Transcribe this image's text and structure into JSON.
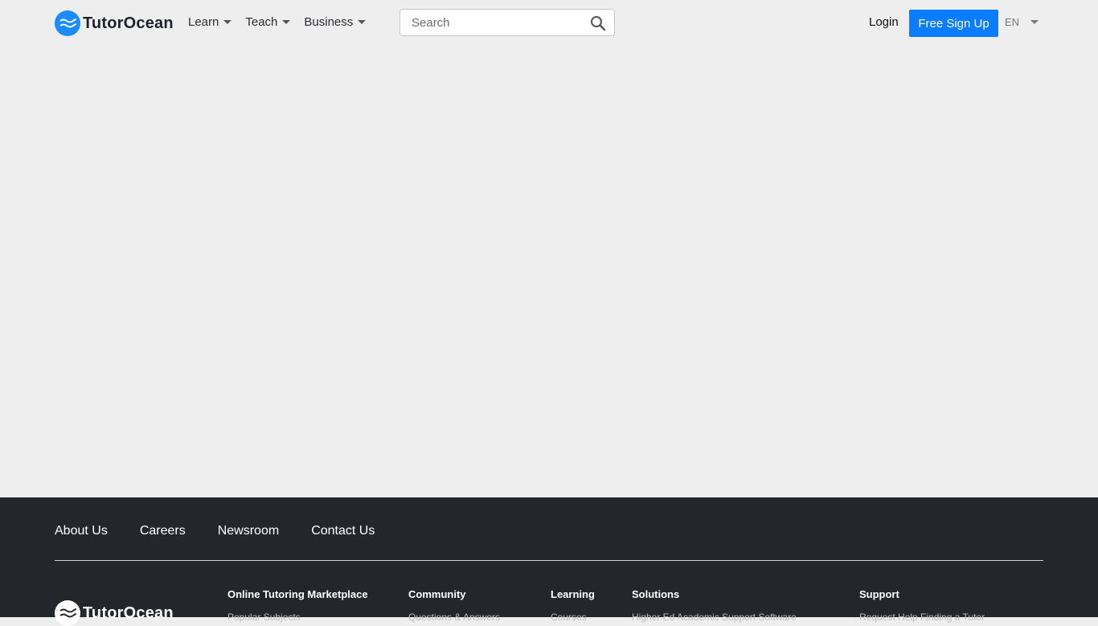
{
  "header": {
    "brand": "TutorOcean",
    "nav": [
      {
        "label": "Learn"
      },
      {
        "label": "Teach"
      },
      {
        "label": "Business"
      }
    ],
    "search": {
      "placeholder": "Search",
      "value": ""
    },
    "login_label": "Login",
    "signup_label": "Free Sign Up",
    "language": "EN",
    "colors": {
      "brand": "#1a8cff",
      "cta": "#0a7cff"
    }
  },
  "footer": {
    "links": [
      "About Us",
      "Careers",
      "Newsroom",
      "Contact Us"
    ],
    "brand": "TutorOcean",
    "columns": [
      {
        "title": "Online Tutoring Marketplace",
        "first_item": "Popular Subjects"
      },
      {
        "title": "Community",
        "first_item": "Questions & Answers"
      },
      {
        "title": "Learning",
        "first_item": "Courses"
      },
      {
        "title": "Solutions",
        "first_item": "Higher Ed Academic Support Software"
      },
      {
        "title": "Support",
        "first_item": "Request Help Finding a Tutor"
      }
    ],
    "background": "#23272b"
  }
}
